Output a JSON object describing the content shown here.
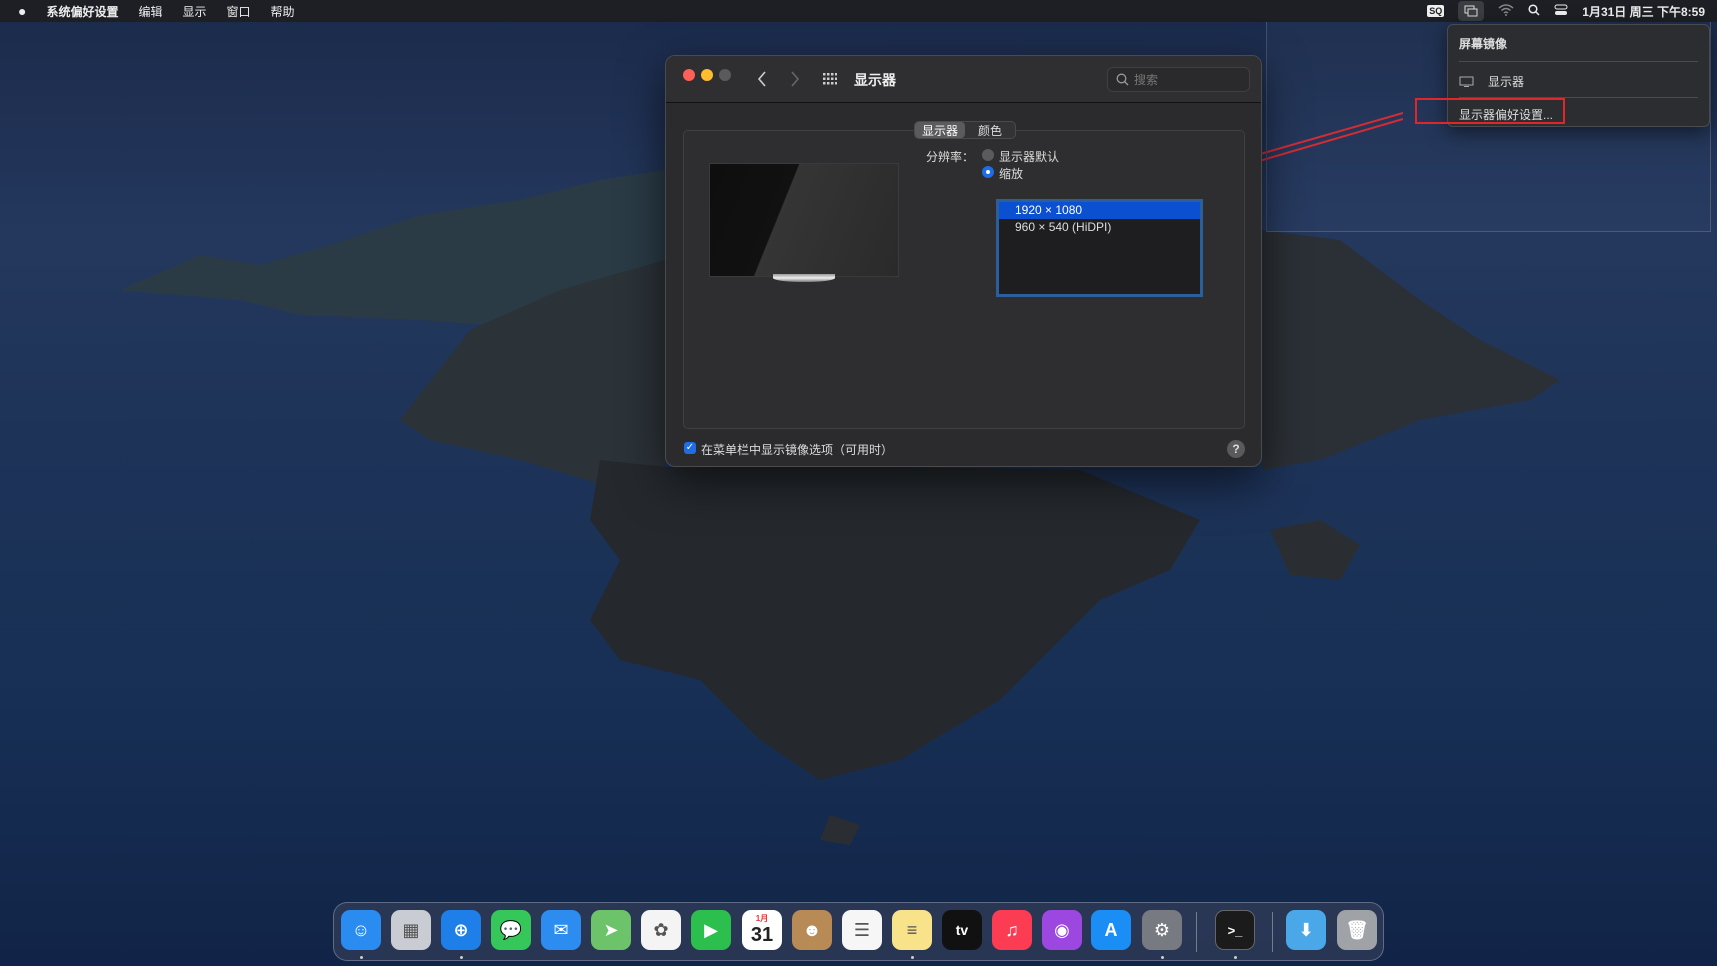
{
  "menubar": {
    "apple_icon": "apple-logo",
    "items": [
      "系统偏好设置",
      "编辑",
      "显示",
      "窗口",
      "帮助"
    ],
    "status": {
      "sq_label": "SQ",
      "clock": "1月31日 周三 下午8:59"
    }
  },
  "mirror_menu": {
    "title": "屏幕镜像",
    "display_item": "显示器",
    "prefs_item": "显示器偏好设置..."
  },
  "annotation": {
    "color": "#e0262b"
  },
  "window": {
    "title": "显示器",
    "search_placeholder": "搜索",
    "tabs": [
      {
        "label": "显示器",
        "selected": true
      },
      {
        "label": "颜色",
        "selected": false
      }
    ],
    "resolution_label": "分辨率：",
    "options": [
      {
        "label": "显示器默认",
        "selected": false
      },
      {
        "label": "缩放",
        "selected": true
      }
    ],
    "resolutions": [
      {
        "label": "1920 × 1080",
        "selected": true
      },
      {
        "label": "960 × 540 (HiDPI)",
        "selected": false
      }
    ],
    "mirror_checkbox": {
      "label": "在菜单栏中显示镜像选项（可用时）",
      "checked": true
    },
    "help_label": "?"
  },
  "colors": {
    "accent": "#0b50d0",
    "close": "#fe5f57",
    "minimize": "#febc2e",
    "zoom_disabled": "#5a5a5c"
  },
  "dock": {
    "calendar_month": "1月",
    "calendar_day": "31",
    "tv_label": "tv",
    "terminal_label": ">_",
    "items": [
      {
        "name": "finder",
        "bg": "#2a8cf0",
        "glyph": "☺",
        "dot": true
      },
      {
        "name": "launchpad",
        "bg": "#c9ccd3",
        "glyph": "▦",
        "dot": false
      },
      {
        "name": "safari",
        "bg": "#1e7fe8",
        "glyph": "⊕",
        "dot": true
      },
      {
        "name": "messages",
        "bg": "#35c759",
        "glyph": "💬",
        "dot": false
      },
      {
        "name": "mail",
        "bg": "#2d8cf0",
        "glyph": "✉",
        "dot": false
      },
      {
        "name": "maps",
        "bg": "#6cc36a",
        "glyph": "➤",
        "dot": false
      },
      {
        "name": "photos",
        "bg": "#f4f4f4",
        "glyph": "✿",
        "dot": false
      },
      {
        "name": "facetime",
        "bg": "#2dbf4e",
        "glyph": "▶",
        "dot": false
      },
      {
        "name": "calendar",
        "bg": "#ffffff",
        "glyph": "",
        "dot": false
      },
      {
        "name": "contacts",
        "bg": "#b88a55",
        "glyph": "☻",
        "dot": false
      },
      {
        "name": "reminders",
        "bg": "#f6f6f6",
        "glyph": "☰",
        "dot": false
      },
      {
        "name": "notes",
        "bg": "#f8e28a",
        "glyph": "≡",
        "dot": true
      },
      {
        "name": "tv",
        "bg": "#111111",
        "glyph": "",
        "dot": false
      },
      {
        "name": "music",
        "bg": "#fb3c52",
        "glyph": "♫",
        "dot": false
      },
      {
        "name": "podcasts",
        "bg": "#9b47e0",
        "glyph": "◉",
        "dot": false
      },
      {
        "name": "app-store",
        "bg": "#1a8ef5",
        "glyph": "A",
        "dot": false
      },
      {
        "name": "system-preferences",
        "bg": "#777a80",
        "glyph": "⚙",
        "dot": true
      },
      {
        "name": "terminal",
        "bg": "#1b1b1b",
        "glyph": "",
        "dot": true
      },
      {
        "name": "downloads",
        "bg": "#4aa8e8",
        "glyph": "⬇",
        "dot": false
      },
      {
        "name": "trash",
        "bg": "#9fa3a8",
        "glyph": "🗑",
        "dot": false
      }
    ]
  }
}
